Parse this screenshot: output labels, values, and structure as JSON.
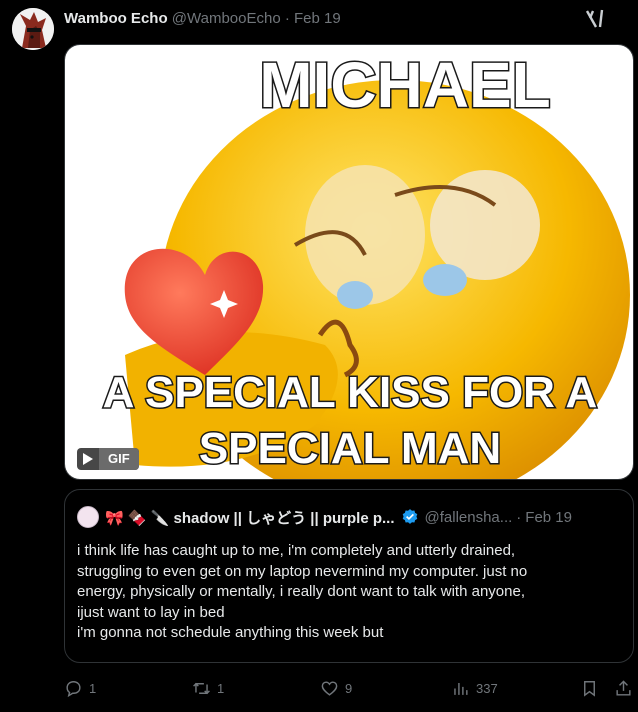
{
  "tweet": {
    "author_name": "Wamboo Echo",
    "handle": "@WambooEcho",
    "separator": "·",
    "date": "Feb 19"
  },
  "media": {
    "top_caption": "MICHAEL",
    "bottom_caption_line1": "A SPECIAL KISS FOR A",
    "bottom_caption_line2": "SPECIAL MAN",
    "gif_label": "GIF"
  },
  "quote": {
    "author_name": "🎀 🍫 🔪 shadow || しゃどう || purple p...",
    "handle": "@fallensha...",
    "separator": "·",
    "date": "Feb 19",
    "lines": [
      "i think life has caught up to me, i'm completely and utterly drained,",
      "struggling to even get on my laptop nevermind my computer. just no",
      "energy, physically or mentally, i really dont want to talk with anyone,",
      "ijust want to lay in bed",
      "i'm gonna not schedule anything this week but"
    ]
  },
  "actions": {
    "replies": "1",
    "reposts": "1",
    "likes": "9",
    "views": "337"
  },
  "colors": {
    "background": "#000000",
    "text": "#e7e9ea",
    "muted": "#71767b",
    "border": "#2f3336",
    "verified": "#1d9bf0"
  }
}
